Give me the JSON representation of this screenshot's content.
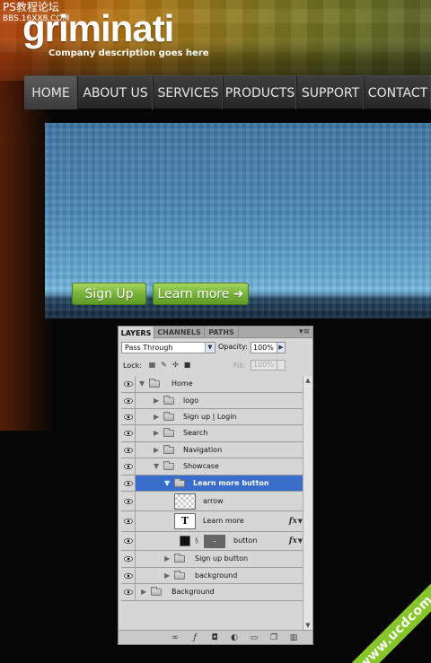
{
  "site": {
    "ps_mark": "PS教程论坛",
    "ps_sub": "BBS.16XX8.COM",
    "logo": "griminati",
    "tagline": "Company description goes here"
  },
  "nav": {
    "items": [
      "HOME",
      "ABOUT US",
      "SERVICES",
      "PRODUCTS",
      "SUPPORT",
      "CONTACT"
    ],
    "active": "HOME"
  },
  "showcase": {
    "signup_label": "Sign Up",
    "learn_label": "Learn more ➜"
  },
  "layers_panel": {
    "tabs": [
      "LAYERS",
      "CHANNELS",
      "PATHS"
    ],
    "blend_mode": "Pass Through",
    "opacity_label": "Opacity:",
    "opacity_value": "100%",
    "lock_label": "Lock:",
    "fill_label": "Fill:",
    "fill_value": "100%",
    "layers": [
      {
        "name": "Home",
        "type": "group",
        "expanded": true
      },
      {
        "name": "logo",
        "type": "group",
        "expanded": false
      },
      {
        "name": "Sign up  |  Login",
        "type": "group",
        "expanded": false
      },
      {
        "name": "Search",
        "type": "group",
        "expanded": false
      },
      {
        "name": "Navigation",
        "type": "group",
        "expanded": false
      },
      {
        "name": "Showcase",
        "type": "group",
        "expanded": true
      },
      {
        "name": "Learn more button",
        "type": "group",
        "expanded": true,
        "selected": true
      },
      {
        "name": "arrow",
        "type": "shape"
      },
      {
        "name": "Learn more",
        "type": "text",
        "fx": true
      },
      {
        "name": "button",
        "type": "shape",
        "fx": true
      },
      {
        "name": "Sign up  button",
        "type": "group",
        "expanded": false
      },
      {
        "name": "background",
        "type": "group",
        "expanded": false
      },
      {
        "name": "Background",
        "type": "group",
        "expanded": false
      }
    ],
    "fx_label": "fx",
    "text_thumb": "T"
  },
  "watermark": "www.ucdcom.com",
  "colors": {
    "selection": "#3a6ccb",
    "button_green": "#78b33a",
    "watermark_green": "#86c62b"
  }
}
